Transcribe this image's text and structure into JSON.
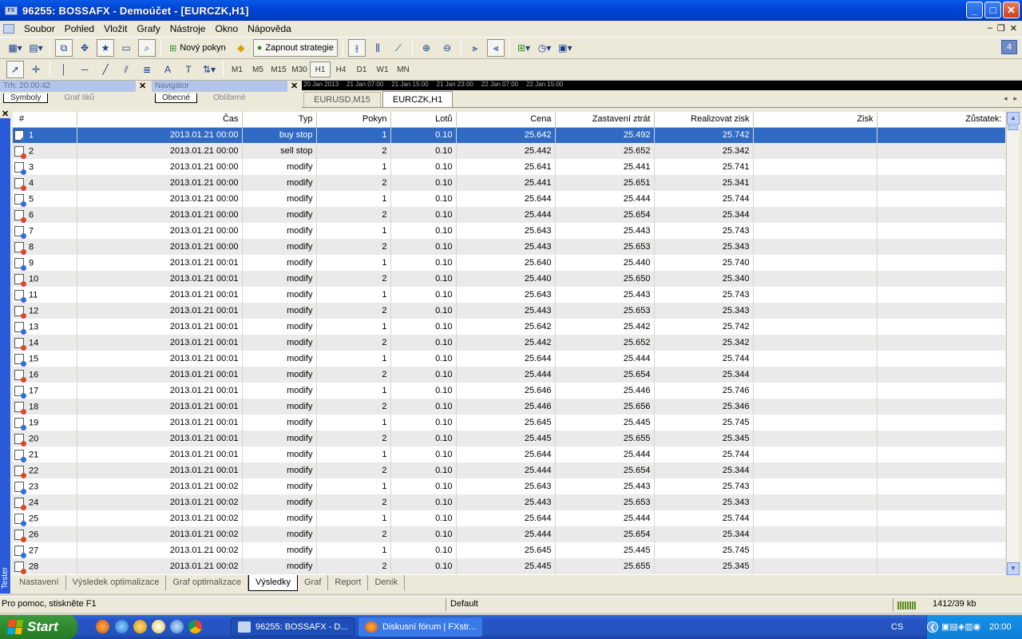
{
  "window": {
    "title": "96255: BOSSAFX - Demoúčet - [EURCZK,H1]",
    "logo_text": "FX"
  },
  "menu": [
    "Soubor",
    "Pohled",
    "Vložit",
    "Grafy",
    "Nástroje",
    "Okno",
    "Nápověda"
  ],
  "toolbar": {
    "new_order": "Nový pokyn",
    "strategy": "Zapnout strategie",
    "badge": "4"
  },
  "timeframes": [
    "M1",
    "M5",
    "M15",
    "M30",
    "H1",
    "H4",
    "D1",
    "W1",
    "MN"
  ],
  "active_timeframe": "H1",
  "market_watch": {
    "title": "Trh: 20:00:42",
    "tabs": [
      "Symboly",
      "Graf tiků"
    ]
  },
  "navigator": {
    "title": "Navigátor",
    "tabs": [
      "Obecné",
      "Oblíbené"
    ]
  },
  "chart_axis": [
    "20 Jan 2013",
    "21 Jan 07:00",
    "21 Jan 15:00",
    "21 Jan 23:00",
    "22 Jan 07:00",
    "22 Jan 15:00"
  ],
  "chart_tabs": [
    "EURUSD,M15",
    "EURCZK,H1"
  ],
  "active_chart_tab": "EURCZK,H1",
  "table": {
    "columns": [
      "#",
      "Čas",
      "Typ",
      "Pokyn",
      "Lotů",
      "Cena",
      "Zastavení ztrát",
      "Realizovat zisk",
      "Zisk",
      "Zůstatek:"
    ],
    "rows": [
      [
        "1",
        "2013.01.21 00:00",
        "buy stop",
        "1",
        "0.10",
        "25.642",
        "25.492",
        "25.742",
        "",
        ""
      ],
      [
        "2",
        "2013.01.21 00:00",
        "sell stop",
        "2",
        "0.10",
        "25.442",
        "25.652",
        "25.342",
        "",
        ""
      ],
      [
        "3",
        "2013.01.21 00:00",
        "modify",
        "1",
        "0.10",
        "25.641",
        "25.441",
        "25.741",
        "",
        ""
      ],
      [
        "4",
        "2013.01.21 00:00",
        "modify",
        "2",
        "0.10",
        "25.441",
        "25.651",
        "25.341",
        "",
        ""
      ],
      [
        "5",
        "2013.01.21 00:00",
        "modify",
        "1",
        "0.10",
        "25.644",
        "25.444",
        "25.744",
        "",
        ""
      ],
      [
        "6",
        "2013.01.21 00:00",
        "modify",
        "2",
        "0.10",
        "25.444",
        "25.654",
        "25.344",
        "",
        ""
      ],
      [
        "7",
        "2013.01.21 00:00",
        "modify",
        "1",
        "0.10",
        "25.643",
        "25.443",
        "25.743",
        "",
        ""
      ],
      [
        "8",
        "2013.01.21 00:00",
        "modify",
        "2",
        "0.10",
        "25.443",
        "25.653",
        "25.343",
        "",
        ""
      ],
      [
        "9",
        "2013.01.21 00:01",
        "modify",
        "1",
        "0.10",
        "25.640",
        "25.440",
        "25.740",
        "",
        ""
      ],
      [
        "10",
        "2013.01.21 00:01",
        "modify",
        "2",
        "0.10",
        "25.440",
        "25.650",
        "25.340",
        "",
        ""
      ],
      [
        "11",
        "2013.01.21 00:01",
        "modify",
        "1",
        "0.10",
        "25.643",
        "25.443",
        "25.743",
        "",
        ""
      ],
      [
        "12",
        "2013.01.21 00:01",
        "modify",
        "2",
        "0.10",
        "25.443",
        "25.653",
        "25.343",
        "",
        ""
      ],
      [
        "13",
        "2013.01.21 00:01",
        "modify",
        "1",
        "0.10",
        "25.642",
        "25.442",
        "25.742",
        "",
        ""
      ],
      [
        "14",
        "2013.01.21 00:01",
        "modify",
        "2",
        "0.10",
        "25.442",
        "25.652",
        "25.342",
        "",
        ""
      ],
      [
        "15",
        "2013.01.21 00:01",
        "modify",
        "1",
        "0.10",
        "25.644",
        "25.444",
        "25.744",
        "",
        ""
      ],
      [
        "16",
        "2013.01.21 00:01",
        "modify",
        "2",
        "0.10",
        "25.444",
        "25.654",
        "25.344",
        "",
        ""
      ],
      [
        "17",
        "2013.01.21 00:01",
        "modify",
        "1",
        "0.10",
        "25.646",
        "25.446",
        "25.746",
        "",
        ""
      ],
      [
        "18",
        "2013.01.21 00:01",
        "modify",
        "2",
        "0.10",
        "25.446",
        "25.656",
        "25.346",
        "",
        ""
      ],
      [
        "19",
        "2013.01.21 00:01",
        "modify",
        "1",
        "0.10",
        "25.645",
        "25.445",
        "25.745",
        "",
        ""
      ],
      [
        "20",
        "2013.01.21 00:01",
        "modify",
        "2",
        "0.10",
        "25.445",
        "25.655",
        "25.345",
        "",
        ""
      ],
      [
        "21",
        "2013.01.21 00:01",
        "modify",
        "1",
        "0.10",
        "25.644",
        "25.444",
        "25.744",
        "",
        ""
      ],
      [
        "22",
        "2013.01.21 00:01",
        "modify",
        "2",
        "0.10",
        "25.444",
        "25.654",
        "25.344",
        "",
        ""
      ],
      [
        "23",
        "2013.01.21 00:02",
        "modify",
        "1",
        "0.10",
        "25.643",
        "25.443",
        "25.743",
        "",
        ""
      ],
      [
        "24",
        "2013.01.21 00:02",
        "modify",
        "2",
        "0.10",
        "25.443",
        "25.653",
        "25.343",
        "",
        ""
      ],
      [
        "25",
        "2013.01.21 00:02",
        "modify",
        "1",
        "0.10",
        "25.644",
        "25.444",
        "25.744",
        "",
        ""
      ],
      [
        "26",
        "2013.01.21 00:02",
        "modify",
        "2",
        "0.10",
        "25.444",
        "25.654",
        "25.344",
        "",
        ""
      ],
      [
        "27",
        "2013.01.21 00:02",
        "modify",
        "1",
        "0.10",
        "25.645",
        "25.445",
        "25.745",
        "",
        ""
      ],
      [
        "28",
        "2013.01.21 00:02",
        "modify",
        "2",
        "0.10",
        "25.445",
        "25.655",
        "25.345",
        "",
        ""
      ]
    ],
    "selected_row": 0
  },
  "tester": {
    "label": "Tester",
    "tabs": [
      "Nastavení",
      "Výsledek optimalizace",
      "Graf optimalizace",
      "Výsledky",
      "Graf",
      "Report",
      "Deník"
    ],
    "active_tab": "Výsledky"
  },
  "status": {
    "help": "Pro pomoc, stiskněte F1",
    "profile": "Default",
    "traffic": "1412/39 kb"
  },
  "taskbar": {
    "start": "Start",
    "tasks": [
      "96255: BOSSAFX - D...",
      "Diskusní fórum | FXstr..."
    ],
    "lang": "CS",
    "clock": "20:00"
  }
}
